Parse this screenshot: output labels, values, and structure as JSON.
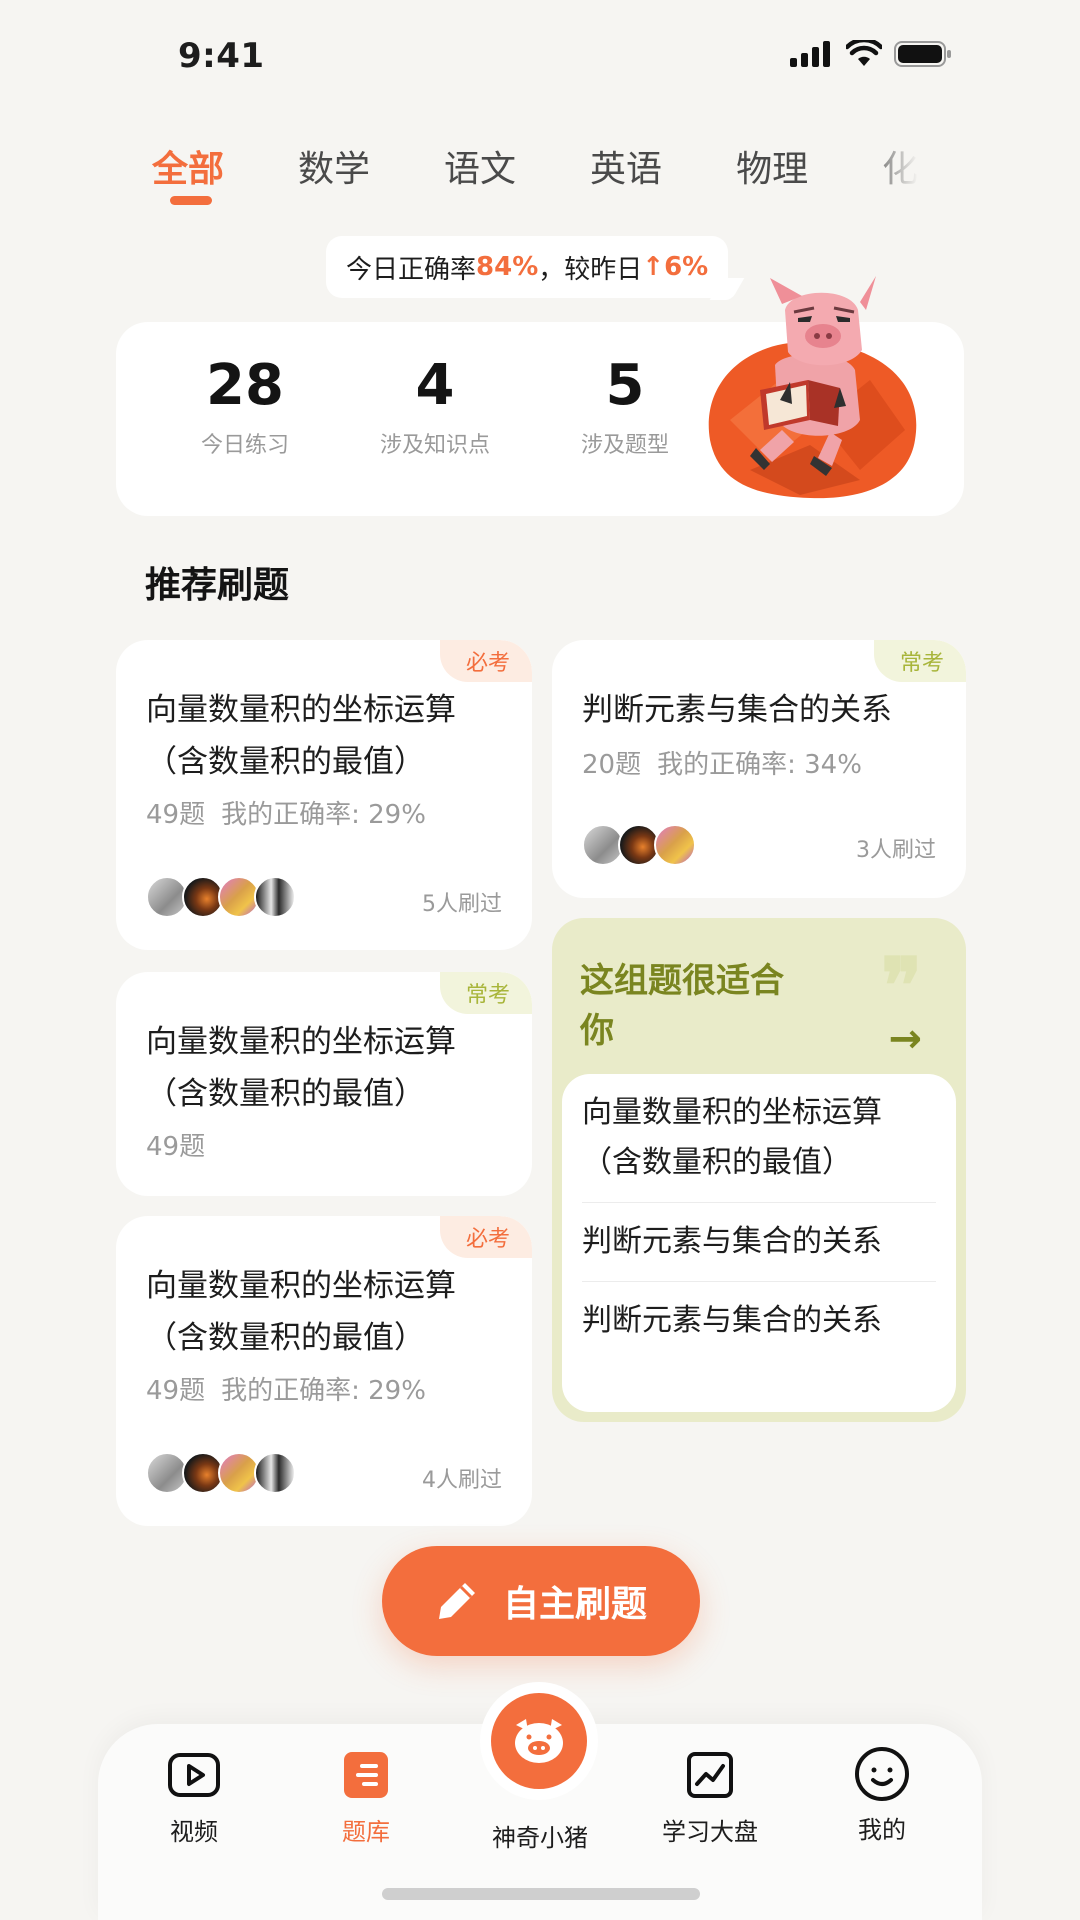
{
  "status": {
    "time": "9:41"
  },
  "tabs": [
    {
      "label": "全部",
      "active": true
    },
    {
      "label": "数学"
    },
    {
      "label": "语文"
    },
    {
      "label": "英语"
    },
    {
      "label": "物理"
    },
    {
      "label": "化"
    }
  ],
  "accuracy": {
    "prefix": "今日正确率",
    "value": "84%",
    "middle": "，较昨日",
    "arrow": "↑",
    "change": "6%"
  },
  "stats": [
    {
      "value": "28",
      "label": "今日练习"
    },
    {
      "value": "4",
      "label": "涉及知识点"
    },
    {
      "value": "5",
      "label": "涉及题型"
    }
  ],
  "section": {
    "title": "推荐刷题"
  },
  "cards": [
    {
      "tag": "必考",
      "title": "向量数量积的坐标运算（含数量积的最值）",
      "questions": "49题",
      "accuracy": "我的正确率: 29%",
      "count": "5人刷过"
    },
    {
      "tag": "常考",
      "title": "判断元素与集合的关系",
      "questions": "20题",
      "accuracy": "我的正确率: 34%",
      "count": "3人刷过"
    },
    {
      "tag": "常考",
      "title": "向量数量积的坐标运算（含数量积的最值）",
      "questions": "49题"
    },
    {
      "tag": "必考",
      "title": "向量数量积的坐标运算（含数量积的最值）",
      "questions": "49题",
      "accuracy": "我的正确率: 29%",
      "count": "4人刷过"
    }
  ],
  "suggest": {
    "title": "这组题很适合你",
    "arrow": "→",
    "quote": "❞",
    "items": [
      "向量数量积的坐标运算（含数量积的最值）",
      "判断元素与集合的关系",
      "判断元素与集合的关系"
    ]
  },
  "fab": {
    "label": "自主刷题"
  },
  "nav": {
    "video": "视频",
    "bank": "题库",
    "pig": "神奇小猪",
    "dashboard": "学习大盘",
    "mine": "我的"
  },
  "colors": {
    "accent": "#f36e3d",
    "olive": "#7a8520",
    "suggest_bg": "#e9ebc9"
  }
}
